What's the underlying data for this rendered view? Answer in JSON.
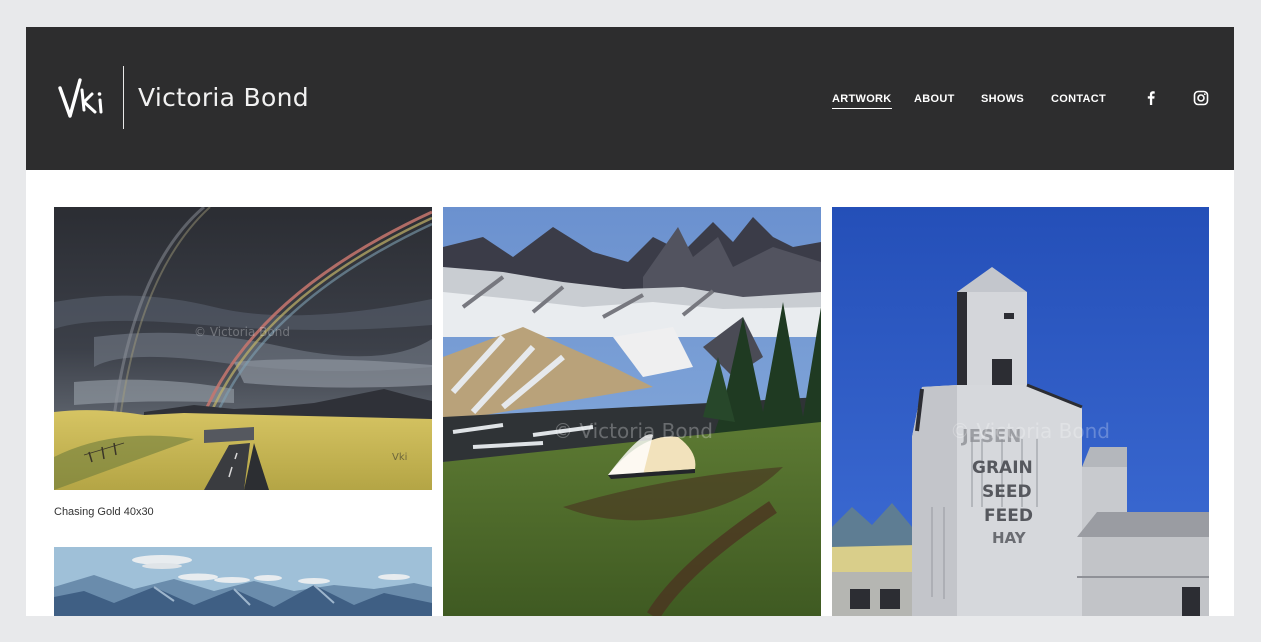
{
  "header": {
    "logo_text": "Vki",
    "site_title": "Victoria Bond"
  },
  "nav": {
    "items": [
      {
        "label": "ARTWORK",
        "active": true
      },
      {
        "label": "ABOUT",
        "active": false
      },
      {
        "label": "SHOWS",
        "active": false
      },
      {
        "label": "CONTACT",
        "active": false
      }
    ],
    "social": [
      "facebook-icon",
      "instagram-icon"
    ]
  },
  "gallery": {
    "watermark": "© Victoria Bond",
    "items": [
      {
        "caption": "Chasing Gold 40x30",
        "signature": "Vki"
      },
      {
        "caption": ""
      },
      {
        "caption": ""
      },
      {
        "caption": ""
      }
    ]
  },
  "elevator_sign": {
    "line1": "GRAIN",
    "line2": "SEED",
    "line3": "FEED",
    "line4": "HAY"
  },
  "colors": {
    "header_bg": "#2d2d2e",
    "page_bg": "#e8e9eb",
    "content_bg": "#ffffff"
  }
}
